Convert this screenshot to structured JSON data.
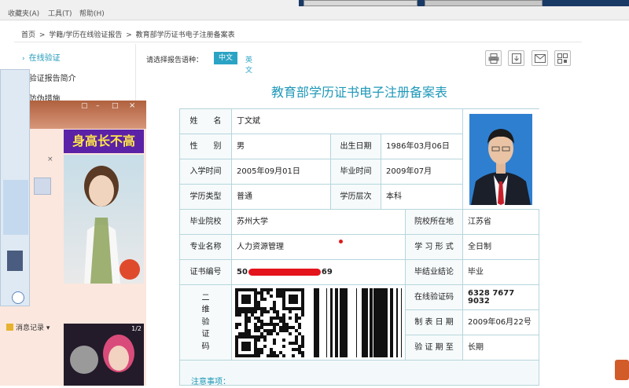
{
  "browser": {
    "menu": [
      "收藏夹(A)",
      "工具(T)",
      "帮助(H)"
    ]
  },
  "breadcrumb": [
    "首页",
    " > ",
    "学籍/学历在线验证报告",
    " > ",
    "教育部学历证书电子注册备案表"
  ],
  "sidebar": {
    "items": [
      {
        "label": "在线验证",
        "active": true
      },
      {
        "label": "验证报告简介",
        "active": false
      },
      {
        "label": "防伪措施",
        "active": false
      }
    ]
  },
  "language": {
    "label": "请选择报告语种：",
    "options": [
      "中文",
      "英文"
    ],
    "selected": "中文"
  },
  "tools": [
    "print-icon",
    "download-icon",
    "mail-icon",
    "qrcode-icon"
  ],
  "document": {
    "title": "教育部学历证书电子注册备案表",
    "fields": {
      "name_label": "姓　　名",
      "name": "丁文斌",
      "gender_label": "性　　别",
      "gender": "男",
      "birth_label": "出生日期",
      "birth": "1986年03月06日",
      "enroll_label": "入学时间",
      "enroll": "2005年09月01日",
      "grad_label": "毕业时间",
      "grad": "2009年07月",
      "type_label": "学历类型",
      "type": "普通",
      "level_label": "学历层次",
      "level": "本科",
      "school_label": "毕业院校",
      "school": "苏州大学",
      "location_label": "院校所在地",
      "location": "江苏省",
      "major_label": "专业名称",
      "major": "人力资源管理",
      "form_label": "学 习 形 式",
      "form": "全日制",
      "cert_label": "证书编号",
      "cert_prefix": "50",
      "cert_suffix": "69",
      "conclusion_label": "毕结业结论",
      "conclusion": "毕业",
      "qr_label": "二\n维\n验\n证\n码",
      "code_label": "在线验证码",
      "code": "6328 7677 9032",
      "date_label": "制 表 日 期",
      "date": "2009年06月22号",
      "valid_label": "验 证 期 至",
      "valid": "长期"
    },
    "notes_label": "注意事项："
  },
  "popup": {
    "ad_title": "身高长不高",
    "msg_record": "消息记录",
    "ad_counter": "1/2"
  },
  "colors": {
    "accent": "#1f98b8",
    "table_border": "#b6d6dc",
    "ad_bg": "#5b22a8",
    "ad_text": "#ffe648"
  }
}
